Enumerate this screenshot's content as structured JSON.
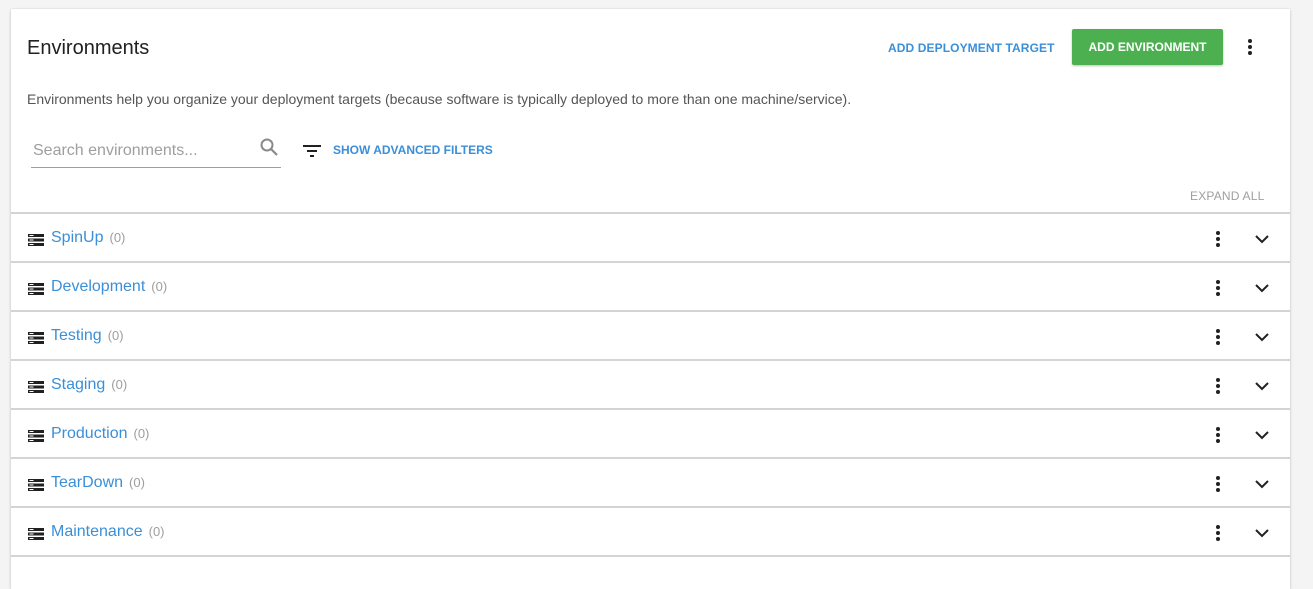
{
  "header": {
    "title": "Environments",
    "add_deployment_target_label": "ADD DEPLOYMENT TARGET",
    "add_environment_label": "ADD ENVIRONMENT",
    "more_icon": "more-vertical-icon"
  },
  "description": "Environments help you organize your deployment targets (because software is typically deployed to more than one machine/service).",
  "search": {
    "placeholder": "Search environments...",
    "value": "",
    "icon": "search-icon"
  },
  "filters": {
    "icon": "filter-list-icon",
    "label": "SHOW ADVANCED FILTERS"
  },
  "expand_all_label": "EXPAND ALL",
  "colors": {
    "accent": "#3a8fd8",
    "primary_button": "#4cb050",
    "muted": "#9e9e9e"
  },
  "environments": [
    {
      "name": "SpinUp",
      "count": "(0)"
    },
    {
      "name": "Development",
      "count": "(0)"
    },
    {
      "name": "Testing",
      "count": "(0)"
    },
    {
      "name": "Staging",
      "count": "(0)"
    },
    {
      "name": "Production",
      "count": "(0)"
    },
    {
      "name": "TearDown",
      "count": "(0)"
    },
    {
      "name": "Maintenance",
      "count": "(0)"
    }
  ]
}
